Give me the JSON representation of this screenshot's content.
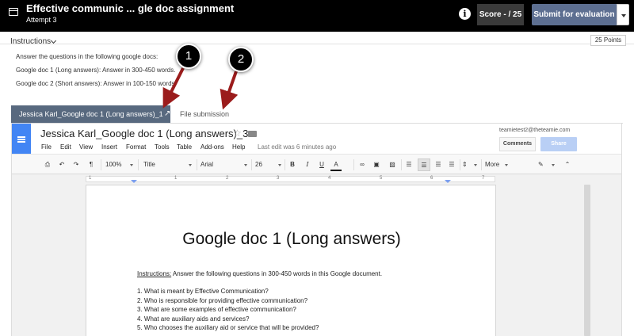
{
  "topbar": {
    "title": "Effective communic ... gle doc assignment",
    "subtitle": "Attempt 3",
    "score_label": "Score - / 25",
    "submit_label": "Submit for evaluation",
    "info_icon": "info-icon"
  },
  "instructions": {
    "heading": "Instructions",
    "points": "25 Points",
    "lines": [
      "Answer the questions in the following google docs:",
      "Google doc 1 (Long answers): Answer in 300-450 words.",
      "Google doc 2 (Short answers): Answer in 100-150 words."
    ]
  },
  "callouts": [
    "1",
    "2"
  ],
  "tabs": {
    "active": "Jessica Karl_Google doc 1 (Long answers)_1",
    "expand_icon": "↗",
    "file_submission": "File submission"
  },
  "doc": {
    "title": "Jessica Karl_Google doc 1 (Long answers)_3",
    "menu": [
      "File",
      "Edit",
      "View",
      "Insert",
      "Format",
      "Tools",
      "Table",
      "Add-ons",
      "Help"
    ],
    "last_edit": "Last edit was 6 minutes ago",
    "email": "teamietest2@theteamie.com",
    "comments_label": "Comments",
    "share_label": "Share",
    "toolbar": {
      "zoom": "100%",
      "style": "Title",
      "font": "Arial",
      "size": "26",
      "more": "More"
    },
    "ruler_numbers": [
      "1",
      "1",
      "2",
      "3",
      "4",
      "5",
      "6",
      "7"
    ],
    "heading": "Google doc 1 (Long answers)",
    "instructions_label": "Instructions:",
    "instructions_text": " Answer the following questions in 300-450 words in this Google document.",
    "questions": [
      "1. What is meant by Effective Communication?",
      "2. Who is responsible for providing effective communication?",
      "3. What are some examples of effective communication?",
      "4. What are auxiliary aids and services?",
      "5. Who chooses the auxiliary aid or service that will be provided?"
    ]
  },
  "colors": {
    "topbar": "#000000",
    "submit": "#5d6f91",
    "tab_active": "#58697f",
    "docs_blue": "#4285f4",
    "arrow": "#9b1c1c"
  }
}
